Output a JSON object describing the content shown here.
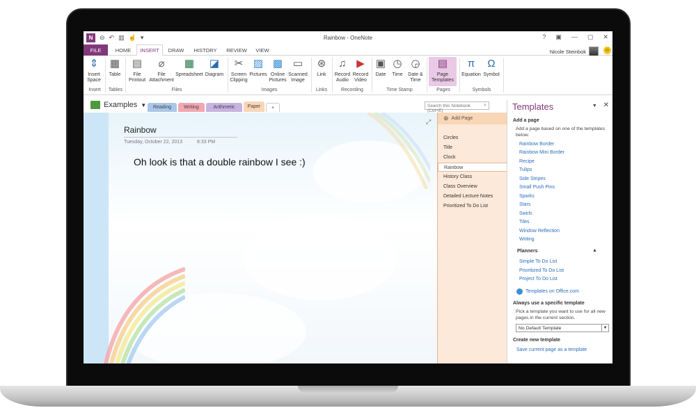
{
  "window": {
    "title": "Rainbow - OneNote",
    "controls": [
      "?",
      "▣",
      "—",
      "▢",
      "✕"
    ]
  },
  "app_logo": "N",
  "tabs": [
    "FILE",
    "HOME",
    "INSERT",
    "DRAW",
    "HISTORY",
    "REVIEW",
    "VIEW"
  ],
  "user": {
    "name": "Nicole Steinbok"
  },
  "ribbon": {
    "buttons": [
      {
        "label": "Insert Space",
        "icon": "insert-space-icon"
      },
      {
        "label": "Table",
        "icon": "table-icon"
      },
      {
        "label": "File Printout",
        "icon": "file-printout-icon"
      },
      {
        "label": "File Attachment",
        "icon": "attachment-icon"
      },
      {
        "label": "Spreadsheet",
        "icon": "spreadsheet-icon"
      },
      {
        "label": "Diagram",
        "icon": "diagram-icon"
      },
      {
        "label": "Screen Clipping",
        "icon": "screen-clipping-icon"
      },
      {
        "label": "Pictures",
        "icon": "pictures-icon"
      },
      {
        "label": "Online Pictures",
        "icon": "online-pictures-icon"
      },
      {
        "label": "Scanned Image",
        "icon": "scanner-icon"
      },
      {
        "label": "Link",
        "icon": "link-icon"
      },
      {
        "label": "Record Audio",
        "icon": "microphone-icon"
      },
      {
        "label": "Record Video",
        "icon": "video-camera-icon"
      },
      {
        "label": "Date",
        "icon": "calendar-icon"
      },
      {
        "label": "Time",
        "icon": "clock-icon"
      },
      {
        "label": "Date & Time",
        "icon": "date-time-icon"
      },
      {
        "label": "Page Templates",
        "icon": "page-templates-icon"
      },
      {
        "label": "Equation",
        "icon": "pi-icon"
      },
      {
        "label": "Symbol",
        "icon": "omega-icon"
      }
    ],
    "groups": [
      "Insert",
      "Tables",
      "Files",
      "Images",
      "Links",
      "Recording",
      "Time Stamp",
      "Pages",
      "Symbols"
    ]
  },
  "notebook": {
    "name": "Examples",
    "sections": [
      {
        "label": "Reading",
        "color": "#a9c7e8"
      },
      {
        "label": "Writing",
        "color": "#f2a7b0"
      },
      {
        "label": "Arithmetic",
        "color": "#c7b3e0"
      },
      {
        "label": "Paper",
        "color": "#f9d6b6"
      },
      {
        "label": "+",
        "color": "#ffffff"
      }
    ],
    "search_placeholder": "Search this Notebook (Ctrl+E)"
  },
  "page": {
    "title": "Rainbow",
    "date": "Tuesday, October 22, 2013",
    "time": "8:33 PM",
    "body": "Oh look is that a double rainbow I see :)"
  },
  "page_list": {
    "add_page": "Add Page",
    "pages": [
      "Circles",
      "Title",
      "Clock",
      "Rainbow",
      "History Class",
      "Class Overview",
      "Detailed Lecture Notes",
      "Prioritized To Do List"
    ],
    "selected": "Rainbow"
  },
  "templates_pane": {
    "title": "Templates",
    "add_page_heading": "Add a page",
    "add_page_text": "Add a page based on one of the templates below.",
    "templates": [
      "Rainbow Border",
      "Rainbow Mini Border",
      "Recipe",
      "Tulips",
      "Side Stripes",
      "Small Push Pins",
      "Sparks",
      "Stars",
      "Swirls",
      "Tiles",
      "Window Reflection",
      "Writing"
    ],
    "planners_heading": "Planners",
    "planners": [
      "Simple To Do List",
      "Prioritized To Do List",
      "Project To Do List"
    ],
    "office_link": "Templates on Office.com",
    "always_heading": "Always use a specific template",
    "always_text": "Pick a template you want to use for all new pages in the current section.",
    "default_select": "No Default Template",
    "create_heading": "Create new template",
    "save_link": "Save current page as a template"
  },
  "colors": {
    "accent": "#80397b",
    "link": "#2a6dbd",
    "page_list_bg": "#fde9d9"
  }
}
